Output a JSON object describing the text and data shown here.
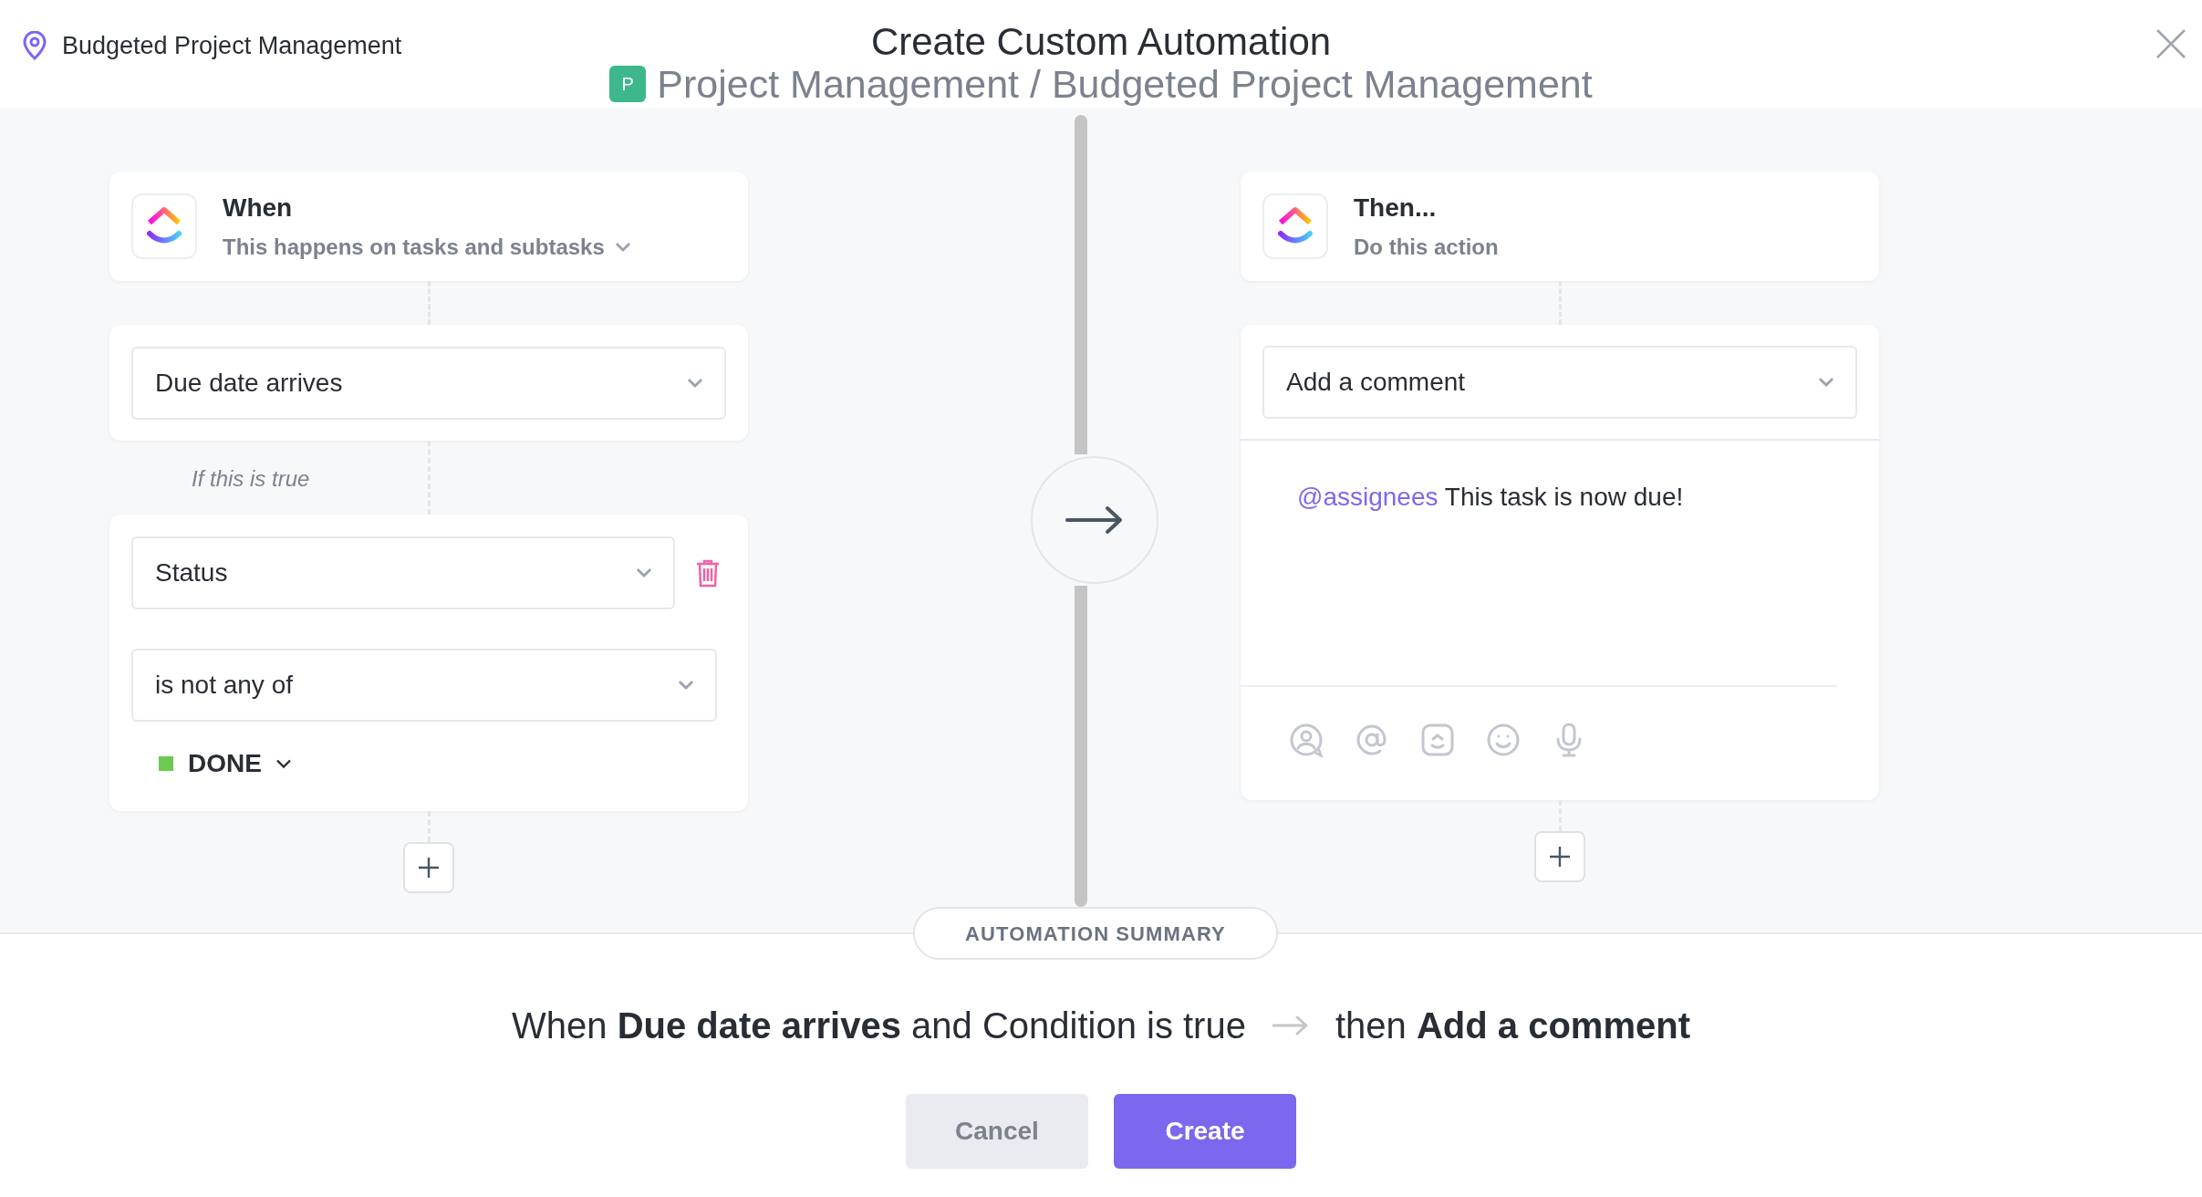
{
  "breadcrumb": {
    "label": "Budgeted Project Management"
  },
  "dialog": {
    "title": "Create Custom Automation",
    "space_badge": "P",
    "location": "Project Management / Budgeted Project Management"
  },
  "trigger": {
    "title": "When",
    "subtitle": "This happens on tasks and subtasks",
    "event": "Due date arrives"
  },
  "condition_label": "If this is true",
  "condition": {
    "field": "Status",
    "operator": "is not any of",
    "value": {
      "label": "DONE",
      "color": "#6bc950"
    }
  },
  "action": {
    "title": "Then...",
    "subtitle": "Do this action",
    "type": "Add a comment",
    "mention": "@assignees",
    "comment": "This task is now due!"
  },
  "summary": {
    "label": "AUTOMATION SUMMARY",
    "condition_text": "When **Due date arrives** and Condition is true",
    "action_text": "then **Add a comment**"
  },
  "buttons": [
    {
      "label": "Cancel",
      "kind": "secondary"
    },
    {
      "label": "Create",
      "kind": "primary"
    }
  ]
}
